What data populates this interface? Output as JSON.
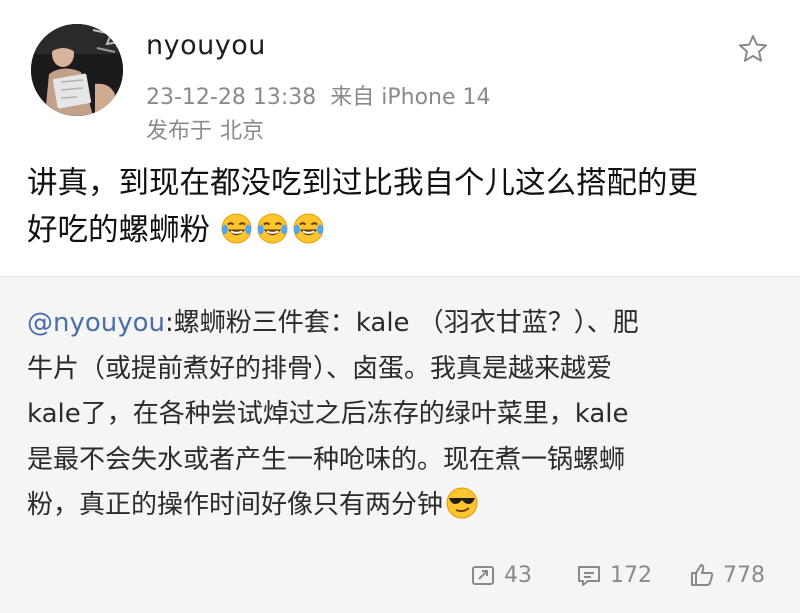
{
  "post": {
    "username": "nyouyou",
    "timestamp": "23-12-28 13:38",
    "source": "来自 iPhone 14",
    "location_prefix": "发布于",
    "location": "北京",
    "text_line1": "讲真，到现在都没吃到过比我自个儿这么搭配的更",
    "text_line2": "好吃的螺蛳粉",
    "emoji_name": "laugh-cry-emoji",
    "emoji_count": 3
  },
  "quote": {
    "mention": "@nyouyou",
    "line1_rest": ":螺蛳粉三件套：kale （羽衣甘蓝？）、肥",
    "line2": "牛片（或提前煮好的排骨）、卤蛋。我真是越来越爱",
    "line3": "kale了，在各种尝试焯过之后冻存的绿叶菜里，kale",
    "line4": "是最不会失水或者产生一种呛味的。现在煮一锅螺蛳",
    "line5": "粉，真正的操作时间好像只有两分钟",
    "end_emoji": "cool-sunglasses-emoji"
  },
  "actions": {
    "repost_count": "43",
    "comment_count": "172",
    "like_count": "778"
  },
  "icons": {
    "favorite": "star-icon",
    "repost": "repost-icon",
    "comment": "comment-icon",
    "like": "thumbs-up-icon"
  },
  "colors": {
    "mention": "#4a6fa8",
    "meta_gray": "#8a8a8a",
    "quote_background": "#f5f5f5"
  }
}
